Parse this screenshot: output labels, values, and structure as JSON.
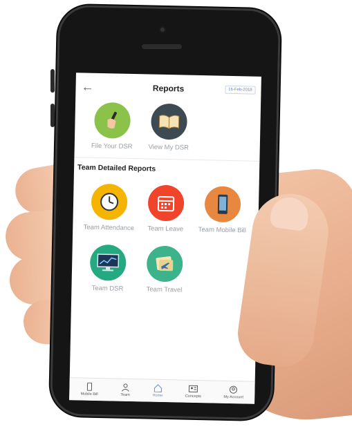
{
  "header": {
    "title": "Reports",
    "date": "16-Feb-2018"
  },
  "top_tiles": [
    {
      "label": "File Your DSR",
      "icon": "pen-hand-icon",
      "color": "#8bc34a"
    },
    {
      "label": "View My DSR",
      "icon": "open-book-icon",
      "color": "#3d4a52"
    }
  ],
  "section": {
    "title": "Team Detailed Reports"
  },
  "team_tiles": [
    {
      "label": "Team Attendance",
      "icon": "clock-icon",
      "color": "#f5b400"
    },
    {
      "label": "Team Leave",
      "icon": "calendar-icon",
      "color": "#f0452b"
    },
    {
      "label": "Team Mobile Bill",
      "icon": "mobile-phone-icon",
      "color": "#e8873f"
    },
    {
      "label": "Team DSR",
      "icon": "monitor-chart-icon",
      "color": "#24a981"
    },
    {
      "label": "Team Travel",
      "icon": "airplane-ticket-icon",
      "color": "#3cb38b"
    }
  ],
  "bottom_nav": [
    {
      "label": "Mobile Bill",
      "icon": "phone-icon"
    },
    {
      "label": "Team",
      "icon": "person-icon"
    },
    {
      "label": "Home",
      "icon": "home-icon"
    },
    {
      "label": "Concepts",
      "icon": "contacts-icon"
    },
    {
      "label": "My Account",
      "icon": "account-icon"
    }
  ]
}
